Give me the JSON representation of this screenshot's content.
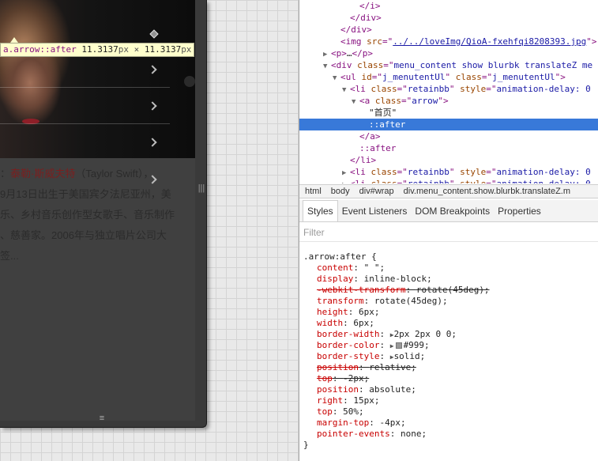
{
  "device": {
    "tooltip": {
      "selector": "a.arrow::after",
      "width": "11.3137",
      "times": "×",
      "height": "11.3137",
      "unit": "px"
    },
    "article": {
      "line1_prefix": "：",
      "line1_name": "泰勒·斯威夫特",
      "line1_rest": "（Taylor Swift），",
      "line2": "9月13日出生于美国宾夕法尼亚州，美",
      "line3": "乐、乡村音乐创作型女歌手、音乐制作",
      "line4": "、慈善家。2006年与独立唱片公司大",
      "line5": "签..."
    },
    "resize_right_glyph": "|||",
    "resize_bottom_glyph": "≡"
  },
  "elements_panel": {
    "lines": [
      {
        "indent": 6,
        "tri": "",
        "parts": [
          [
            "t-tag",
            "</i>"
          ]
        ]
      },
      {
        "indent": 5,
        "tri": "",
        "parts": [
          [
            "t-tag",
            "</div>"
          ]
        ]
      },
      {
        "indent": 4,
        "tri": "",
        "parts": [
          [
            "t-tag",
            "</div>"
          ]
        ]
      },
      {
        "indent": 4,
        "tri": "",
        "parts": [
          [
            "t-tag",
            "<img "
          ],
          [
            "t-attr",
            "src"
          ],
          [
            "t-tag",
            "=\""
          ],
          [
            "t-link",
            "../../loveImg/QioA-fxehfqi8208393.jpg"
          ],
          [
            "t-tag",
            "\">"
          ]
        ]
      },
      {
        "indent": 3,
        "tri": "▶",
        "parts": [
          [
            "t-tag",
            "<p>"
          ],
          [
            "t-text",
            "…"
          ],
          [
            "t-tag",
            "</p>"
          ]
        ]
      },
      {
        "indent": 3,
        "tri": "▼",
        "parts": [
          [
            "t-tag",
            "<div "
          ],
          [
            "t-attr",
            "class"
          ],
          [
            "t-tag",
            "=\""
          ],
          [
            "t-val",
            "menu_content show blurbk translateZ me"
          ]
        ]
      },
      {
        "indent": 4,
        "tri": "▼",
        "parts": [
          [
            "t-tag",
            "<ul "
          ],
          [
            "t-attr",
            "id"
          ],
          [
            "t-tag",
            "=\""
          ],
          [
            "t-val",
            "j_menutentUl"
          ],
          [
            "t-tag",
            "\" "
          ],
          [
            "t-attr",
            "class"
          ],
          [
            "t-tag",
            "=\""
          ],
          [
            "t-val",
            "j_menutentUl"
          ],
          [
            "t-tag",
            "\">"
          ]
        ]
      },
      {
        "indent": 5,
        "tri": "▼",
        "parts": [
          [
            "t-tag",
            "<li "
          ],
          [
            "t-attr",
            "class"
          ],
          [
            "t-tag",
            "=\""
          ],
          [
            "t-val",
            "retainbb"
          ],
          [
            "t-tag",
            "\" "
          ],
          [
            "t-attr",
            "style"
          ],
          [
            "t-tag",
            "=\""
          ],
          [
            "t-val",
            "animation-delay: 0"
          ]
        ]
      },
      {
        "indent": 6,
        "tri": "▼",
        "parts": [
          [
            "t-tag",
            "<a "
          ],
          [
            "t-attr",
            "class"
          ],
          [
            "t-tag",
            "=\""
          ],
          [
            "t-val",
            "arrow"
          ],
          [
            "t-tag",
            "\">"
          ]
        ]
      },
      {
        "indent": 7,
        "tri": "",
        "parts": [
          [
            "t-text",
            "\"首页\""
          ]
        ]
      },
      {
        "indent": 7,
        "tri": "",
        "selected": true,
        "parts": [
          [
            "t-text",
            "::after"
          ]
        ]
      },
      {
        "indent": 6,
        "tri": "",
        "parts": [
          [
            "t-tag",
            "</a>"
          ]
        ]
      },
      {
        "indent": 6,
        "tri": "",
        "parts": [
          [
            "t-pseudo",
            "::after"
          ]
        ]
      },
      {
        "indent": 5,
        "tri": "",
        "parts": [
          [
            "t-tag",
            "</li>"
          ]
        ]
      },
      {
        "indent": 5,
        "tri": "▶",
        "parts": [
          [
            "t-tag",
            "<li "
          ],
          [
            "t-attr",
            "class"
          ],
          [
            "t-tag",
            "=\""
          ],
          [
            "t-val",
            "retainbb"
          ],
          [
            "t-tag",
            "\" "
          ],
          [
            "t-attr",
            "style"
          ],
          [
            "t-tag",
            "=\""
          ],
          [
            "t-val",
            "animation-delay: 0"
          ]
        ]
      },
      {
        "indent": 5,
        "tri": "▶",
        "parts": [
          [
            "t-tag",
            "<li "
          ],
          [
            "t-attr",
            "class"
          ],
          [
            "t-tag",
            "=\""
          ],
          [
            "t-val",
            "retainbb"
          ],
          [
            "t-tag",
            "\" "
          ],
          [
            "t-attr",
            "style"
          ],
          [
            "t-tag",
            "=\""
          ],
          [
            "t-val",
            "animation-delay: 0"
          ]
        ]
      }
    ]
  },
  "breadcrumbs": [
    "html",
    "body",
    "div#wrap",
    "div.menu_content.show.blurbk.translateZ.m"
  ],
  "subtabs": [
    "Styles",
    "Event Listeners",
    "DOM Breakpoints",
    "Properties"
  ],
  "filter_placeholder": "Filter",
  "styles": {
    "selector": ".arrow:after {",
    "close": "}",
    "declarations": [
      {
        "name": "content",
        "value": "\" \";",
        "strike": false
      },
      {
        "name": "display",
        "value": "inline-block;",
        "strike": false
      },
      {
        "name": "-webkit-transform",
        "value": "rotate(45deg);",
        "strike": true
      },
      {
        "name": "transform",
        "value": "rotate(45deg);",
        "strike": false
      },
      {
        "name": "height",
        "value": "6px;",
        "strike": false
      },
      {
        "name": "width",
        "value": "6px;",
        "strike": false
      },
      {
        "name": "border-width",
        "value": "2px 2px 0 0;",
        "strike": false,
        "expander": true
      },
      {
        "name": "border-color",
        "value": "#999;",
        "strike": false,
        "expander": true,
        "swatch": "#999999"
      },
      {
        "name": "border-style",
        "value": "solid;",
        "strike": false,
        "expander": true
      },
      {
        "name": "position",
        "value": "relative;",
        "strike": true
      },
      {
        "name": "top",
        "value": "-2px;",
        "strike": true
      },
      {
        "name": "position",
        "value": "absolute;",
        "strike": false
      },
      {
        "name": "right",
        "value": "15px;",
        "strike": false
      },
      {
        "name": "top",
        "value": "50%;",
        "strike": false
      },
      {
        "name": "margin-top",
        "value": "-4px;",
        "strike": false
      },
      {
        "name": "pointer-events",
        "value": "none;",
        "strike": false
      }
    ]
  },
  "colors": {
    "selected_row": "#3879d9",
    "tag": "#881280",
    "attr": "#994500",
    "value": "#1a1aa6",
    "prop_name": "#c80000",
    "tooltip_bg": "#ffffcc"
  }
}
